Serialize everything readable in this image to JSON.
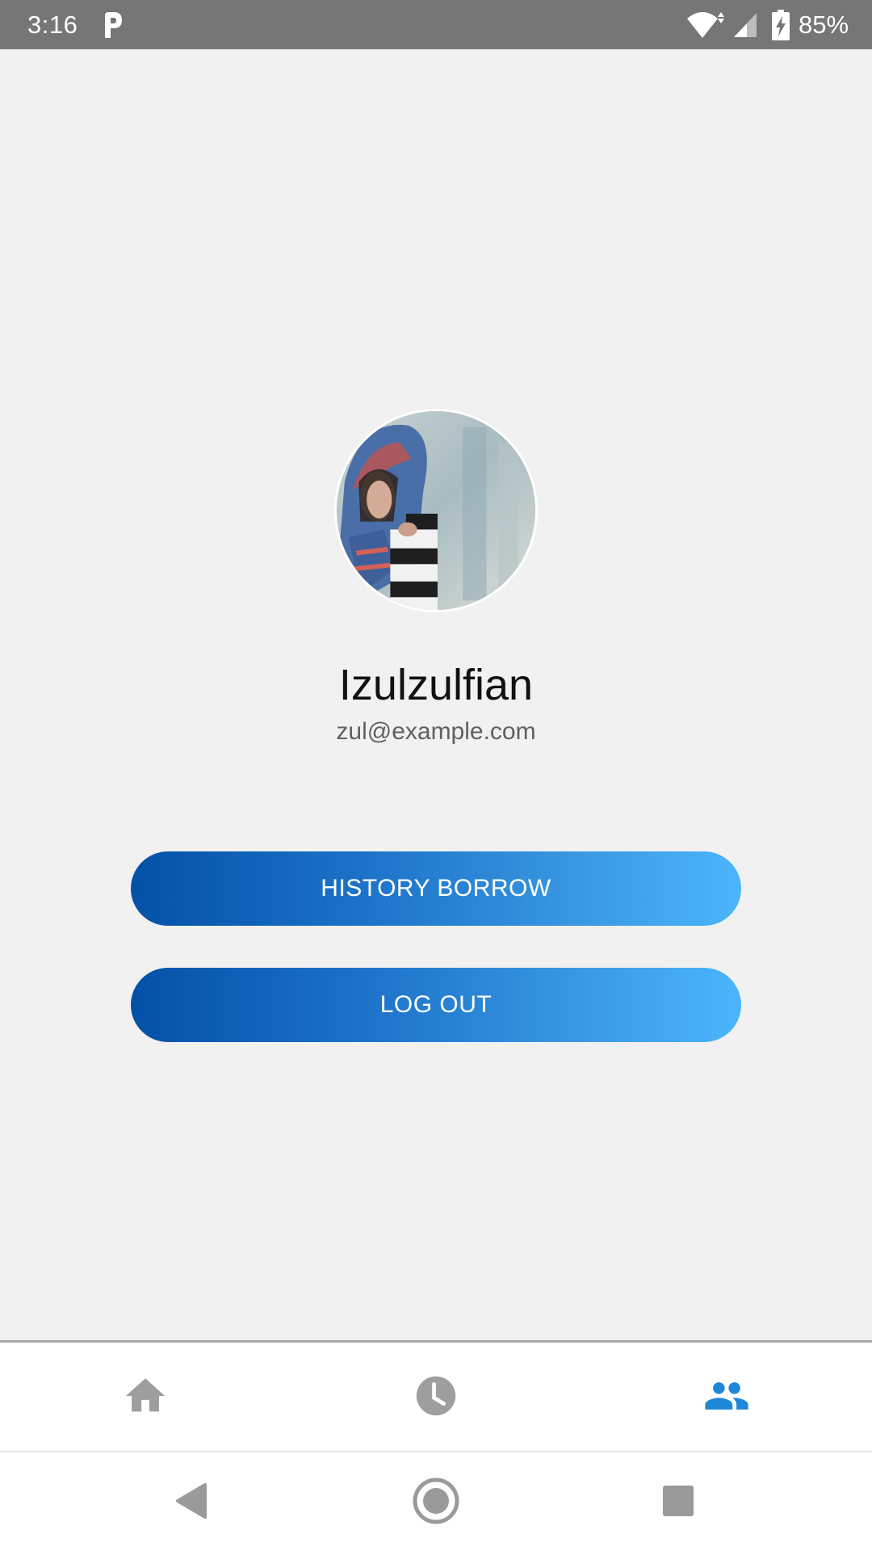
{
  "status_bar": {
    "time": "3:16",
    "battery": "85%",
    "icons": [
      "parking-icon",
      "wifi-icon",
      "signal-icon",
      "battery-charging-icon"
    ]
  },
  "profile": {
    "name": "Izulzulfian",
    "email": "zul@example.com"
  },
  "buttons": {
    "history_borrow": "HISTORY BORROW",
    "log_out": "LOG OUT"
  },
  "bottom_nav": {
    "items": [
      {
        "icon": "home-icon",
        "active": false
      },
      {
        "icon": "clock-icon",
        "active": false
      },
      {
        "icon": "people-icon",
        "active": true
      }
    ],
    "active_color": "#1e88d8",
    "inactive_color": "#9e9e9e"
  },
  "system_nav": {
    "icons": [
      "back-icon",
      "home-circle-icon",
      "recents-icon"
    ]
  },
  "colors": {
    "status_bar_bg": "#767676",
    "background": "#f1f1f1",
    "button_gradient_start": "#0451a6",
    "button_gradient_end": "#4bb5fb"
  }
}
